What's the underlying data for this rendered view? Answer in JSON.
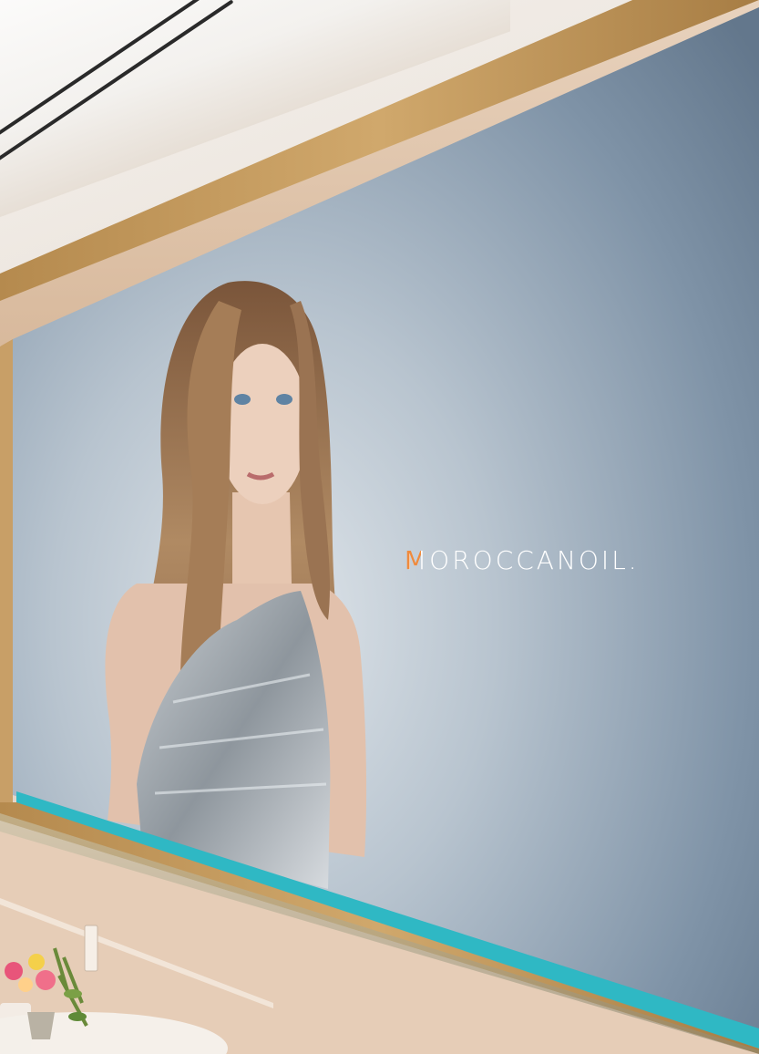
{
  "brand": {
    "logo_text": "MOROCCANOIL.",
    "accent_letter_color": "#f08a3c",
    "logo_color": "#ffffff"
  },
  "colors": {
    "banner_top": "#6c8095",
    "banner_bottom": "#c2ccd4",
    "teal_stripe": "#2fb8c4",
    "gold_trim": "#b58a4e",
    "wall": "#e6cdb7"
  }
}
